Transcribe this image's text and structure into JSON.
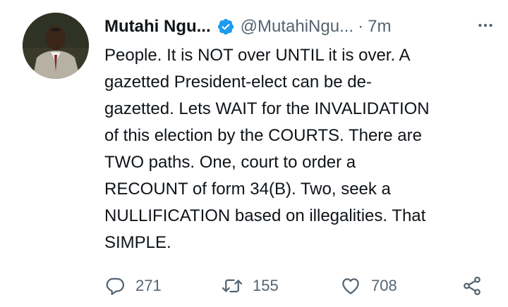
{
  "tweet": {
    "author": {
      "display_name": "Mutahi Ngu...",
      "handle": "@MutahiNgu...",
      "verified": true
    },
    "separator": "·",
    "timestamp": "7m",
    "text": "People. It is NOT over UNTIL it is over. A\ngazetted President-elect can be de-\ngazetted. Lets WAIT for the INVALIDATION\nof this election by the COURTS. There are\nTWO paths. One, court to order a\nRECOUNT of form 34(B). Two, seek a\nNULLIFICATION based on illegalities. That\nSIMPLE.",
    "stats": {
      "replies": "271",
      "retweets": "155",
      "likes": "708"
    }
  },
  "icons": {
    "verified": "verified-badge-icon",
    "more": "more-horizontal-icon",
    "reply": "reply-icon",
    "retweet": "retweet-icon",
    "like": "heart-icon",
    "share": "share-icon"
  },
  "colors": {
    "verified_blue": "#1d9bf0",
    "secondary_text": "#536471",
    "primary_text": "#0f1419"
  }
}
